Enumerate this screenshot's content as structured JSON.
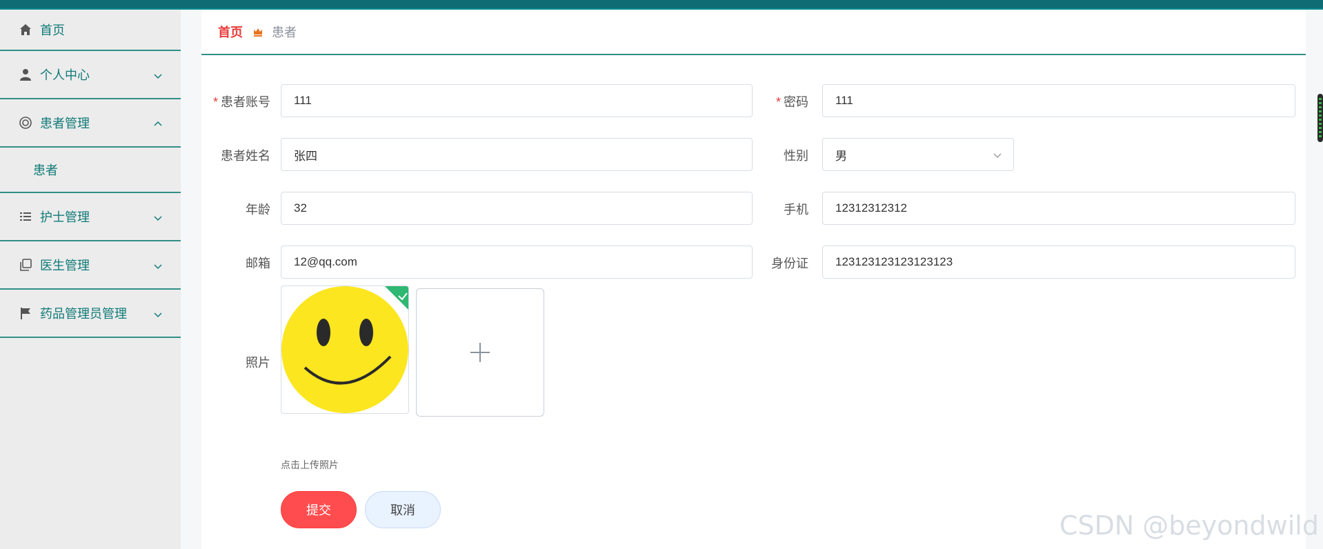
{
  "sidebar": {
    "items": [
      {
        "label": "首页",
        "icon": "home-icon"
      },
      {
        "label": "个人中心",
        "icon": "user-icon"
      },
      {
        "label": "患者管理",
        "icon": "lifebuoy-icon"
      },
      {
        "label": "护士管理",
        "icon": "list-icon"
      },
      {
        "label": "医生管理",
        "icon": "copy-icon"
      },
      {
        "label": "药品管理员管理",
        "icon": "flag-icon"
      }
    ],
    "submenu_label": "患者"
  },
  "breadcrumb": {
    "home": "首页",
    "current": "患者"
  },
  "form": {
    "account_label": "患者账号",
    "account_value": "111",
    "password_label": "密码",
    "password_value": "111",
    "name_label": "患者姓名",
    "name_value": "张四",
    "gender_label": "性别",
    "gender_value": "男",
    "age_label": "年龄",
    "age_value": "32",
    "phone_label": "手机",
    "phone_value": "12312312312",
    "email_label": "邮箱",
    "email_value": "12@qq.com",
    "idcard_label": "身份证",
    "idcard_value": "123123123123123123",
    "photo_label": "照片",
    "upload_hint": "点击上传照片",
    "required_mark": "*"
  },
  "buttons": {
    "submit": "提交",
    "cancel": "取消"
  },
  "watermark": "CSDN @beyondwild",
  "colors": {
    "accent": "#0f7a77",
    "danger": "#ff4d4f",
    "topbar": "#0f6b74"
  }
}
